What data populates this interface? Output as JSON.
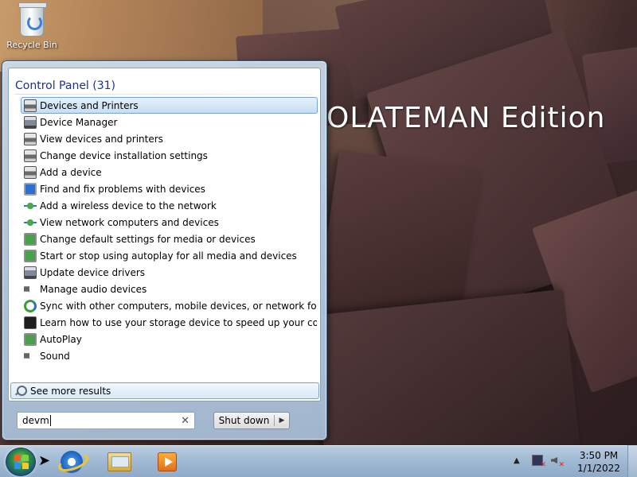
{
  "desktop": {
    "edition_text": "OLATEMAN Edition",
    "recycle_bin_label": "Recycle Bin"
  },
  "start_menu": {
    "header": "Control Panel (31)",
    "results": [
      {
        "label": "Devices and Printers",
        "icon": "devices-printers-icon",
        "selected": true
      },
      {
        "label": "Device Manager",
        "icon": "device-manager-icon"
      },
      {
        "label": "View devices and printers",
        "icon": "devices-printers-icon"
      },
      {
        "label": "Change device installation settings",
        "icon": "devices-printers-icon"
      },
      {
        "label": "Add a device",
        "icon": "devices-printers-icon"
      },
      {
        "label": "Find and fix problems with devices",
        "icon": "troubleshoot-icon"
      },
      {
        "label": "Add a wireless device to the network",
        "icon": "network-icon"
      },
      {
        "label": "View network computers and devices",
        "icon": "network-icon"
      },
      {
        "label": "Change default settings for media or devices",
        "icon": "autoplay-icon"
      },
      {
        "label": "Start or stop using autoplay for all media and devices",
        "icon": "autoplay-icon"
      },
      {
        "label": "Update device drivers",
        "icon": "device-manager-icon"
      },
      {
        "label": "Manage audio devices",
        "icon": "speaker-icon"
      },
      {
        "label": "Sync with other computers, mobile devices, or network folders",
        "icon": "sync-icon"
      },
      {
        "label": "Learn how to use your storage device to speed up your computer",
        "icon": "storage-icon"
      },
      {
        "label": "AutoPlay",
        "icon": "autoplay-icon"
      },
      {
        "label": "Sound",
        "icon": "speaker-icon"
      }
    ],
    "see_more": "See more results",
    "search_value": "devm",
    "shutdown_label": "Shut down"
  },
  "taskbar": {
    "pinned": [
      "internet-explorer-icon",
      "windows-explorer-icon",
      "media-player-icon"
    ],
    "clock_time": "3:50 PM",
    "clock_date": "1/1/2022"
  }
}
